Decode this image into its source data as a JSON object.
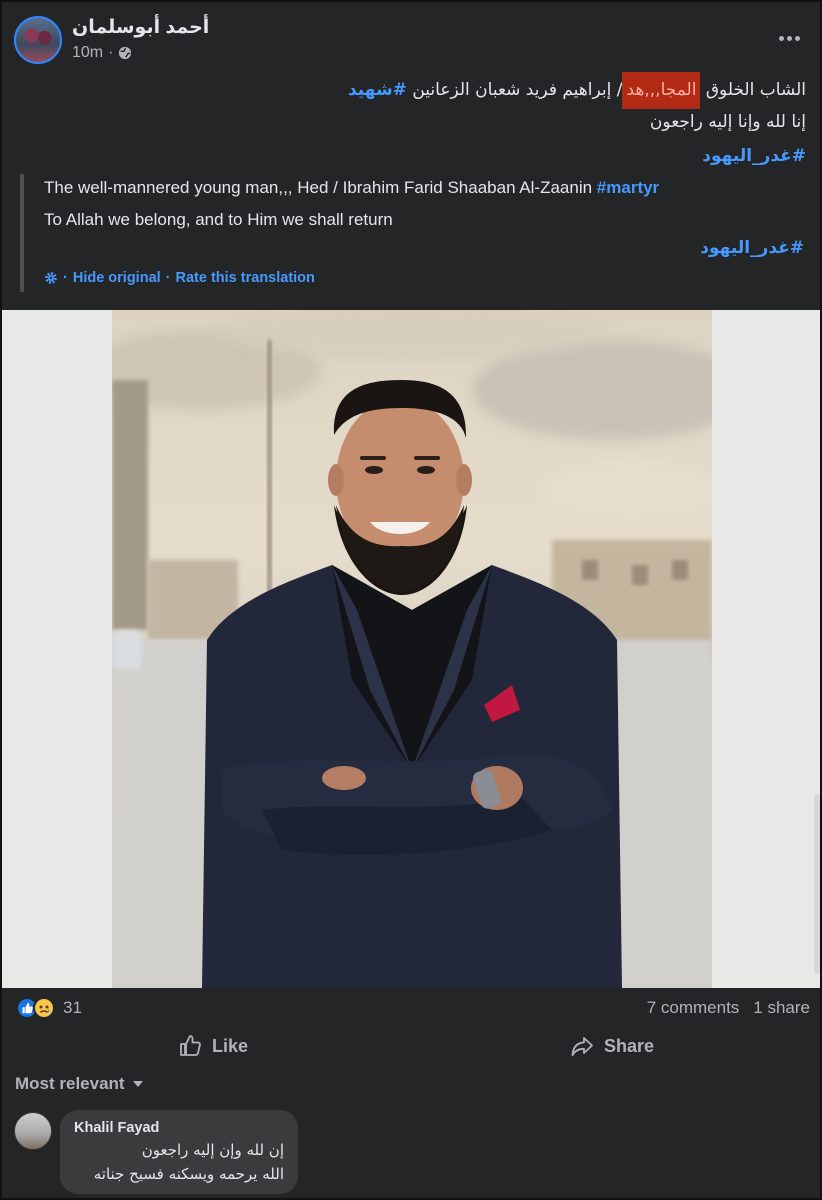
{
  "post": {
    "author": "أحمد أبوسلمان",
    "time": "10m",
    "text": {
      "line1_start": "الشاب الخلوق ",
      "line1_highlight": "المجا,,,هد",
      "line1_end": "/ إبراهيم فريد شعبان الزعانين ",
      "line1_hashtag": "#شهيد",
      "line2": "إنا لله وإنا إليه راجعون",
      "line3_hashtag": "#غدر_اليهود"
    },
    "translation": {
      "line1": "The well-mannered young man,,, Hed / Ibrahim Farid Shaaban Al-Zaanin ",
      "line1_hashtag": "#martyr",
      "line2": "To Allah we belong, and to Him we shall return",
      "hashtag": "#غدر_اليهود",
      "hide_original": "Hide original",
      "separator": "·",
      "rate": "Rate this translation"
    }
  },
  "stats": {
    "reactions_count": "31",
    "comments": "7 comments",
    "shares": "1 share"
  },
  "actions": {
    "like": "Like",
    "share": "Share"
  },
  "comments": {
    "sort_label": "Most relevant",
    "items": [
      {
        "author": "Khalil Fayad",
        "line1": "إن لله وإن إليه راجعون",
        "line2": "الله يرحمه ويسكنه فسيح جناته"
      }
    ]
  },
  "colors": {
    "background": "#242526",
    "link": "#4599ff",
    "text": "#e4e6eb",
    "muted": "#b0b3b8",
    "highlight": "#b32a14"
  },
  "icons": [
    "globe-icon",
    "more-icon",
    "gear-icon",
    "like-icon",
    "share-icon",
    "like-reaction-icon",
    "sad-reaction-icon",
    "caret-down-icon"
  ]
}
